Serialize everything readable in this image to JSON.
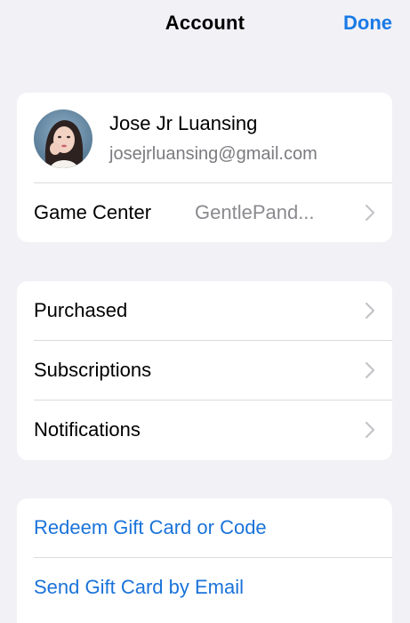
{
  "header": {
    "title": "Account",
    "done_label": "Done"
  },
  "profile": {
    "name": "Jose Jr Luansing",
    "email": "josejrluansing@gmail.com"
  },
  "game_center": {
    "label": "Game Center",
    "value": "GentlePand..."
  },
  "menu": {
    "items": [
      {
        "label": "Purchased"
      },
      {
        "label": "Subscriptions"
      },
      {
        "label": "Notifications"
      }
    ]
  },
  "gift": {
    "items": [
      {
        "label": "Redeem Gift Card or Code"
      },
      {
        "label": "Send Gift Card by Email"
      }
    ]
  },
  "colors": {
    "accent": "#1a7ae6",
    "background": "#f1f1f6",
    "card": "#ffffff",
    "secondary_text": "#7b7b80"
  },
  "icons": {
    "chevron": "chevron-right-icon",
    "avatar": "avatar"
  }
}
